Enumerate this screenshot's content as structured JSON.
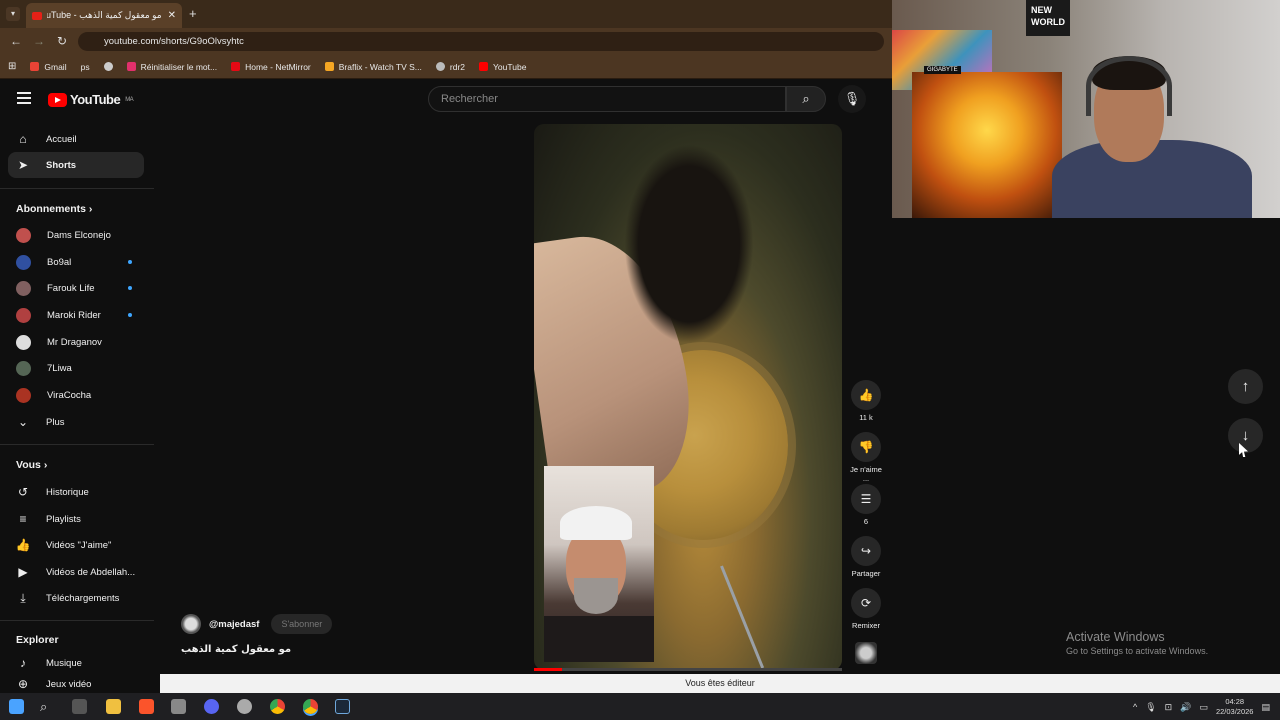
{
  "browser": {
    "tab_title": "مو معقول كمية الذهب - YouTube",
    "url": "youtube.com/shorts/G9oOlvsyhtc",
    "bookmarks": [
      {
        "label": "Gmail",
        "color": "#ea4335"
      },
      {
        "label": "ps",
        "color": "#5f6368"
      },
      {
        "label": "",
        "color": "#cccccc"
      },
      {
        "label": "Réinitialiser le mot...",
        "color": "#e1306c"
      },
      {
        "label": "Home - NetMirror",
        "color": "#e50914"
      },
      {
        "label": "Braflix - Watch TV S...",
        "color": "#f5a623"
      },
      {
        "label": "rdr2",
        "color": "#bbbbbb"
      },
      {
        "label": "YouTube",
        "color": "#ff0000"
      }
    ]
  },
  "youtube": {
    "logo_text": "YouTube",
    "country_code": "MA",
    "search_placeholder": "Rechercher"
  },
  "sidebar": {
    "top": [
      {
        "label": "Accueil",
        "icon": "home-icon"
      },
      {
        "label": "Shorts",
        "icon": "shorts-icon",
        "active": true
      }
    ],
    "subscriptions_header": "Abonnements",
    "subscriptions": [
      {
        "label": "Dams Elconejo",
        "color": "#c0504d",
        "new": false
      },
      {
        "label": "Bo9al",
        "color": "#3050a0",
        "new": true
      },
      {
        "label": "Farouk Life",
        "color": "#806060",
        "new": true
      },
      {
        "label": "Maroki Rider",
        "color": "#b04040",
        "new": true
      },
      {
        "label": "Mr Draganov",
        "color": "#dddddd",
        "new": false
      },
      {
        "label": "7Liwa",
        "color": "#556655",
        "new": false
      },
      {
        "label": "ViraCocha",
        "color": "#aa3322",
        "new": false
      },
      {
        "label": "Plus",
        "color": "",
        "new": false
      }
    ],
    "you_header": "Vous",
    "you_items": [
      {
        "label": "Historique",
        "icon": "history-icon"
      },
      {
        "label": "Playlists",
        "icon": "playlists-icon"
      },
      {
        "label": "Vidéos \"J'aime\"",
        "icon": "like-icon"
      },
      {
        "label": "Vidéos de Abdellah...",
        "icon": "your-videos-icon"
      },
      {
        "label": "Téléchargements",
        "icon": "download-icon"
      }
    ],
    "explore_header": "Explorer",
    "explore_items": [
      {
        "label": "Musique",
        "icon": "music-icon"
      },
      {
        "label": "Jeux vidéo",
        "icon": "gaming-icon"
      }
    ]
  },
  "short": {
    "channel": "@majedasf",
    "subscribe_label": "S'abonner",
    "title": "مو معقول كمية الذهب",
    "progress": 0.09,
    "actions": {
      "likes": "11 k",
      "dislike": "Je n'aime ...",
      "comments": "6",
      "share": "Partager",
      "remix": "Remixer"
    }
  },
  "editor_notice": "Vous êtes éditeur",
  "watermark": {
    "line1": "Activate Windows",
    "line2": "Go to Settings to activate Windows."
  },
  "webcam": {
    "sign_text": "NEW WORLD",
    "monitor_brand": "GIGABYTE"
  },
  "taskbar": {
    "time": "04:28",
    "date": "22/03/2026",
    "icons": [
      {
        "name": "start-icon",
        "color": "#4aa3ff"
      },
      {
        "name": "search-icon",
        "color": "#dddddd"
      },
      {
        "name": "task-view-icon",
        "color": "#dddddd"
      },
      {
        "name": "file-explorer-icon",
        "color": "#f0c040"
      },
      {
        "name": "brave-icon",
        "color": "#fb542b"
      },
      {
        "name": "discord-icon",
        "color": "#5865f2"
      },
      {
        "name": "app-icon",
        "color": "#aaaaaa"
      },
      {
        "name": "chrome-icon",
        "color": "#34a853"
      },
      {
        "name": "chrome-active-icon",
        "color": "#fbbc05"
      },
      {
        "name": "steam-icon",
        "color": "#1b2838"
      }
    ]
  }
}
